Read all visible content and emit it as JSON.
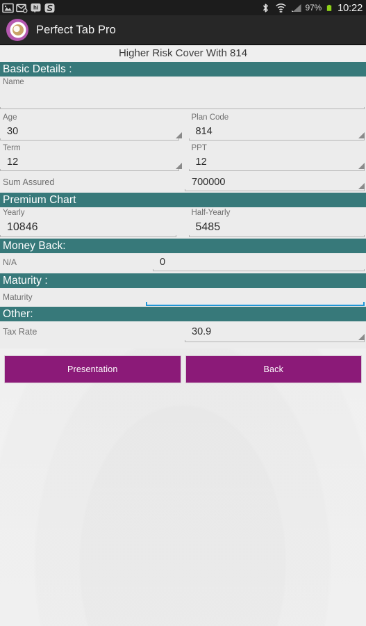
{
  "statusbar": {
    "left_icons": [
      "photo-icon",
      "email-sync-icon",
      "hike-messenger-icon",
      "app-notification-icon"
    ],
    "right_icons": [
      "bluetooth-icon",
      "wifi-icon",
      "cellular-signal-icon"
    ],
    "battery_percent": "97%",
    "battery_icon": "battery-full-icon",
    "clock": "10:22"
  },
  "actionbar": {
    "logo_icon": "perfect-tab-pro-logo",
    "title": "Perfect Tab Pro"
  },
  "page": {
    "title": "Higher Risk Cover With 814"
  },
  "sections": {
    "basic_details": "Basic Details :",
    "premium_chart": "Premium Chart",
    "money_back": "Money Back:",
    "maturity": "Maturity :",
    "other": "Other:"
  },
  "fields": {
    "name": {
      "label": "Name",
      "value": ""
    },
    "age": {
      "label": "Age",
      "value": "30"
    },
    "plan_code": {
      "label": "Plan Code",
      "value": "814"
    },
    "term": {
      "label": "Term",
      "value": "12"
    },
    "ppt": {
      "label": "PPT",
      "value": "12"
    },
    "sum_assured": {
      "label": "Sum Assured",
      "value": "700000"
    },
    "yearly": {
      "label": "Yearly",
      "value": "10846"
    },
    "half_yearly": {
      "label": "Half-Yearly",
      "value": "5485"
    },
    "money_back_na": {
      "label": "N/A",
      "value": "0"
    },
    "maturity": {
      "label": "Maturity",
      "value": ""
    },
    "tax_rate": {
      "label": "Tax Rate",
      "value": "30.9"
    }
  },
  "buttons": {
    "presentation": "Presentation",
    "back": "Back"
  },
  "colors": {
    "section_teal": "#37797a",
    "button_magenta": "#8b1a78",
    "focus_blue": "#2196d6",
    "statusbar_black": "#1c1c1c",
    "actionbar_dark": "#272727",
    "form_bg": "#ececec"
  }
}
